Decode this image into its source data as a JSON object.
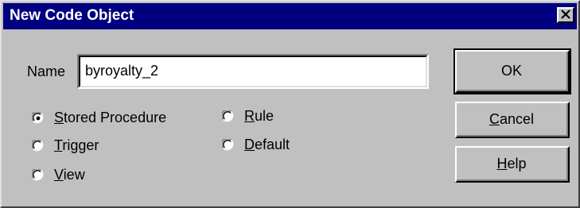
{
  "dialog": {
    "title": "New Code Object",
    "close_icon": "close-icon"
  },
  "name_field": {
    "label": "Name",
    "value": "byroyalty_2"
  },
  "object_types": [
    {
      "label_prefix": "",
      "accel": "S",
      "label_rest": "tored Procedure",
      "selected": true
    },
    {
      "label_prefix": "",
      "accel": "R",
      "label_rest": "ule",
      "selected": false
    },
    {
      "label_prefix": "",
      "accel": "T",
      "label_rest": "rigger",
      "selected": false
    },
    {
      "label_prefix": "",
      "accel": "D",
      "label_rest": "efault",
      "selected": false
    },
    {
      "label_prefix": "",
      "accel": "V",
      "label_rest": "iew",
      "selected": false
    }
  ],
  "buttons": {
    "ok": {
      "label": "OK"
    },
    "cancel": {
      "accel": "C",
      "label_rest": "ancel"
    },
    "help": {
      "accel": "H",
      "label_rest": "elp"
    }
  },
  "colors": {
    "titlebar": "#000080",
    "face": "#c0c0c0"
  }
}
